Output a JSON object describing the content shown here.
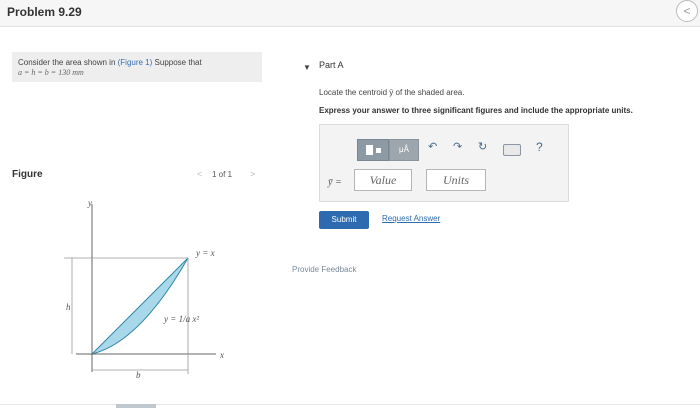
{
  "header": {
    "title": "Problem 9.29",
    "back_icon": "<"
  },
  "problem": {
    "text_before": "Consider the area shown in ",
    "figure_link": "(Figure 1)",
    "text_after": " Suppose that",
    "given": "a = h = b = 130 mm"
  },
  "part_a": {
    "caret": "▼",
    "label": "Part A",
    "instruction": "Locate the centroid ȳ of the shaded area.",
    "express": "Express your answer to three significant figures and include the appropriate units."
  },
  "answer": {
    "variable_label": "ȳ =",
    "value_placeholder": "Value",
    "units_placeholder": "Units",
    "units_button": "μÅ",
    "undo_icon": "↶",
    "redo_icon": "↷",
    "reset_icon": "↻",
    "help_icon": "?"
  },
  "actions": {
    "submit": "Submit",
    "request_answer": "Request Answer",
    "feedback": "Provide Feedback"
  },
  "figure": {
    "label": "Figure",
    "pager": "1 of 1",
    "prev_icon": "<",
    "next_icon": ">",
    "axis_y": "y",
    "axis_x": "x",
    "curve_line": "y = x",
    "curve_parabola": "y = 1/a x²",
    "dim_h": "h",
    "dim_b": "b"
  },
  "colors": {
    "shade": "#a9d8ea",
    "link": "#2e6ab0",
    "submit": "#2e6ab0"
  }
}
